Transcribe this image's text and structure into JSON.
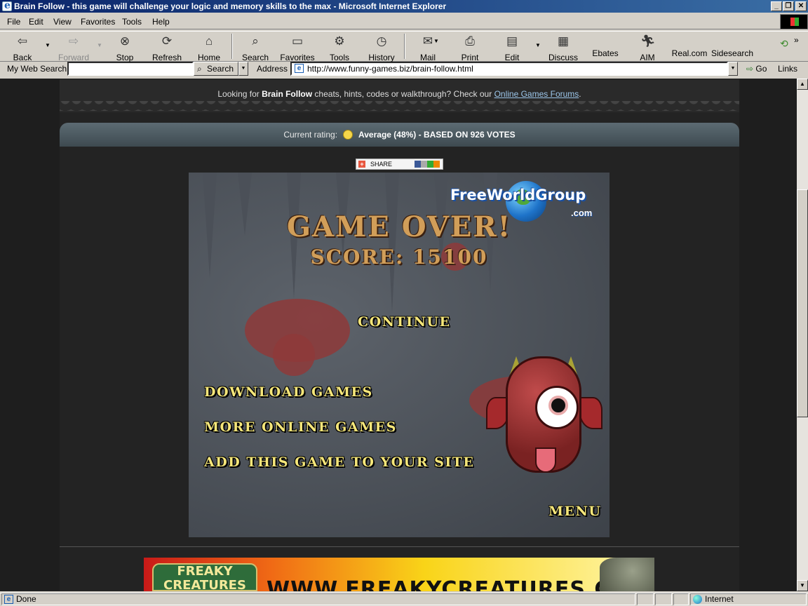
{
  "window": {
    "title": "Brain Follow - this game will challenge your logic and memory skills to the max - Microsoft Internet Explorer",
    "minimize": "_",
    "restore": "❐",
    "close": "✕"
  },
  "menu": [
    "File",
    "Edit",
    "View",
    "Favorites",
    "Tools",
    "Help"
  ],
  "toolbar": {
    "back": "Back",
    "forward": "Forward",
    "stop": "Stop",
    "refresh": "Refresh",
    "home": "Home",
    "search": "Search",
    "favorites": "Favorites",
    "tools": "Tools",
    "history": "History",
    "mail": "Mail",
    "print": "Print",
    "edit": "Edit",
    "discuss": "Discuss",
    "ebates": "Ebates",
    "aim": "AIM",
    "realcom": "Real.com",
    "sidesearch": "Sidesearch"
  },
  "addressbar": {
    "mywebsearch_label": "My Web Search",
    "search_value": "",
    "search_button": "Search",
    "address_label": "Address",
    "url": "http://www.funny-games.biz/brain-follow.html",
    "go_label": "Go",
    "links_label": "Links"
  },
  "page": {
    "forum_prefix": "Looking for ",
    "forum_game": "Brain Follow",
    "forum_middle": " cheats, hints, codes or walkthrough? Check our ",
    "forum_link": "Online Games Forums",
    "forum_suffix": ".",
    "rating_label": "Current rating:",
    "rating_value": "Average (48%) - BASED ON 926 VOTES",
    "share_label": "SHARE"
  },
  "game": {
    "logo_text": "FreeWorldGroup",
    "logo_domain": ".com",
    "game_over": "GAME OVER!",
    "score": "SCORE: 15100",
    "continue": "CONTINUE",
    "download": "DOWNLOAD GAMES",
    "more_online": "MORE ONLINE GAMES",
    "add_game": "ADD THIS GAME TO YOUR SITE",
    "menu": "MENU"
  },
  "banner": {
    "logo_text": "FREAKY CREATURES",
    "url_text": "WWW.FREAKYCREATURES.COM"
  },
  "status": {
    "text": "Done",
    "zone": "Internet"
  }
}
